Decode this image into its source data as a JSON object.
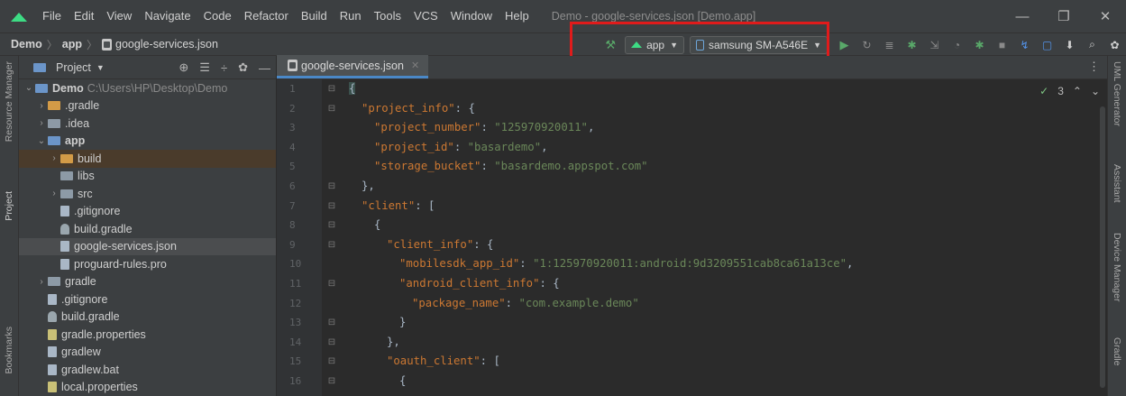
{
  "menu": {
    "items": [
      "File",
      "Edit",
      "View",
      "Navigate",
      "Code",
      "Refactor",
      "Build",
      "Run",
      "Tools",
      "VCS",
      "Window",
      "Help"
    ],
    "window_title": "Demo - google-services.json [Demo.app]"
  },
  "window_controls": {
    "minimize": "—",
    "restore": "❐",
    "close": "✕"
  },
  "breadcrumb": {
    "project": "Demo",
    "module": "app",
    "file": "google-services.json"
  },
  "toolbar": {
    "run_config": "app",
    "device": "samsung SM-A546E",
    "highlight_color": "#e01b1b"
  },
  "left_strip": {
    "resource_manager": "Resource Manager",
    "project": "Project",
    "bookmarks": "Bookmarks"
  },
  "right_strip": {
    "uml": "UML Generator",
    "assistant": "Assistant",
    "device_manager": "Device Manager",
    "gradle": "Gradle"
  },
  "project_panel": {
    "title": "Project",
    "tree": [
      {
        "label": "Demo",
        "path": "C:\\Users\\HP\\Desktop\\Demo"
      },
      {
        "label": ".gradle"
      },
      {
        "label": ".idea"
      },
      {
        "label": "app"
      },
      {
        "label": "build"
      },
      {
        "label": "libs"
      },
      {
        "label": "src"
      },
      {
        "label": ".gitignore"
      },
      {
        "label": "build.gradle"
      },
      {
        "label": "google-services.json"
      },
      {
        "label": "proguard-rules.pro"
      },
      {
        "label": "gradle"
      },
      {
        "label": ".gitignore"
      },
      {
        "label": "build.gradle"
      },
      {
        "label": "gradle.properties"
      },
      {
        "label": "gradlew"
      },
      {
        "label": "gradlew.bat"
      },
      {
        "label": "local.properties"
      }
    ]
  },
  "editor": {
    "tab": "google-services.json",
    "inspection_count": "3",
    "line_numbers": [
      "1",
      "2",
      "3",
      "4",
      "5",
      "6",
      "7",
      "8",
      "9",
      "10",
      "11",
      "12",
      "13",
      "14",
      "15",
      "16"
    ],
    "code": [
      {
        "line": "{"
      },
      {
        "key": "\"project_info\"",
        "rest": ": {"
      },
      {
        "key": "\"project_number\"",
        "value": "\"125970920011\"",
        "tail": ","
      },
      {
        "key": "\"project_id\"",
        "value": "\"basardemo\"",
        "tail": ","
      },
      {
        "key": "\"storage_bucket\"",
        "value": "\"basardemo.appspot.com\"",
        "tail": ""
      },
      {
        "line": "},"
      },
      {
        "key": "\"client\"",
        "rest": ": ["
      },
      {
        "line": "{"
      },
      {
        "key": "\"client_info\"",
        "rest": ": {"
      },
      {
        "key": "\"mobilesdk_app_id\"",
        "value": "\"1:125970920011:android:9d3209551cab8ca61a13ce\"",
        "tail": ","
      },
      {
        "key": "\"android_client_info\"",
        "rest": ": {"
      },
      {
        "key": "\"package_name\"",
        "value": "\"com.example.demo\"",
        "tail": ""
      },
      {
        "line": "}"
      },
      {
        "line": "},"
      },
      {
        "key": "\"oauth_client\"",
        "rest": ": ["
      },
      {
        "line": "{"
      }
    ]
  }
}
